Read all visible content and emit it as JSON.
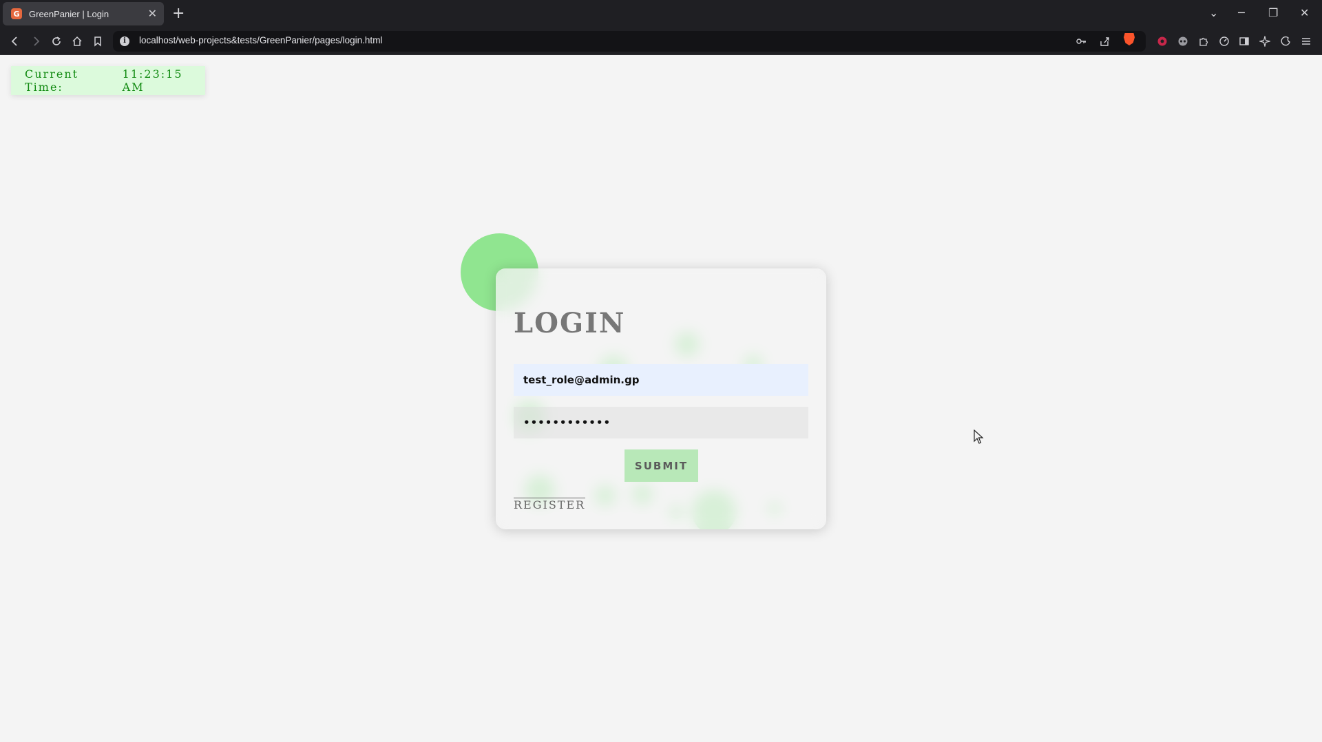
{
  "browser": {
    "tab_title": "GreenPanier | Login",
    "url": "localhost/web-projects&tests/GreenPanier/pages/login.html"
  },
  "clock": {
    "label": "Current Time:",
    "time": "11:23:15 AM"
  },
  "login": {
    "title": "LOGIN",
    "email_value": "test_role@admin.gp",
    "password_mask": "••••••••••••",
    "submit_label": "SUBMIT",
    "register_label": "REGISTER"
  },
  "colors": {
    "accent_green": "#90e590",
    "clock_bg": "#dcfadc",
    "clock_text": "#118a11",
    "submit_bg": "#b8e8b8"
  }
}
